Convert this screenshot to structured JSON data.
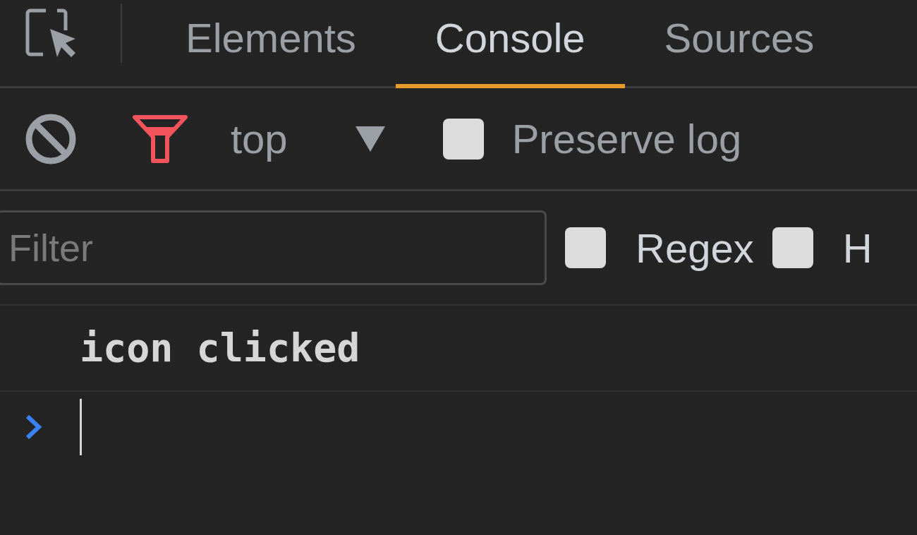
{
  "tabs": [
    {
      "label": "Elements",
      "selected": false
    },
    {
      "label": "Console",
      "selected": true
    },
    {
      "label": "Sources",
      "selected": false
    }
  ],
  "toolbar": {
    "context": "top",
    "preserve_log": {
      "label": "Preserve log",
      "checked": false
    }
  },
  "filter_bar": {
    "placeholder": "Filter",
    "options": [
      {
        "label": "Regex",
        "checked": false
      },
      {
        "label": "H",
        "checked": false
      }
    ]
  },
  "messages": [
    "icon clicked"
  ]
}
